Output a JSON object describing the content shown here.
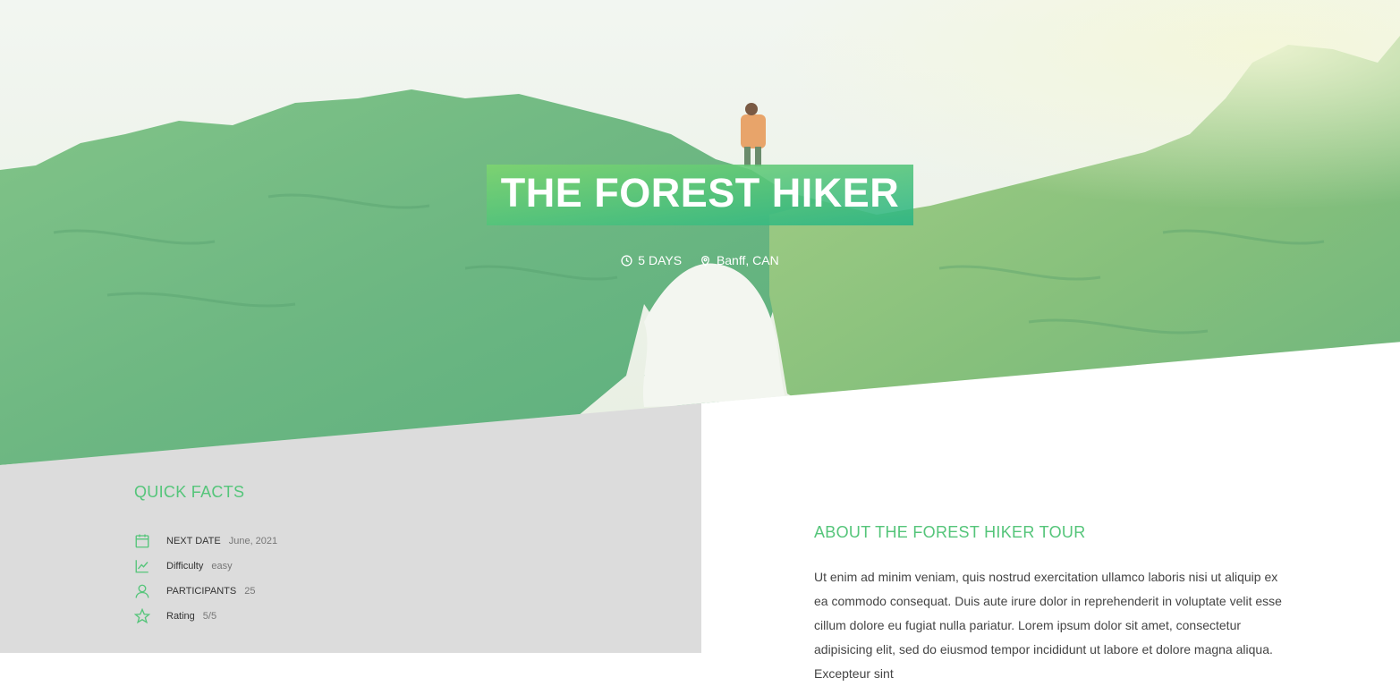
{
  "tour": {
    "title": "THE FOREST HIKER",
    "duration": "5 DAYS",
    "location": "Banff, CAN"
  },
  "quick_facts": {
    "heading": "QUICK FACTS",
    "items": [
      {
        "icon": "calendar-icon",
        "label": "NEXT DATE",
        "value": "June, 2021"
      },
      {
        "icon": "trending-up-icon",
        "label": "Difficulty",
        "value": "easy"
      },
      {
        "icon": "user-icon",
        "label": "PARTICIPANTS",
        "value": "25"
      },
      {
        "icon": "star-icon",
        "label": "Rating",
        "value": "5/5"
      }
    ]
  },
  "about": {
    "heading": "ABOUT THE FOREST HIKER TOUR",
    "text": "Ut enim ad minim veniam, quis nostrud exercitation ullamco laboris nisi ut aliquip ex ea commodo consequat. Duis aute irure dolor in reprehenderit in voluptate velit esse cillum dolore eu fugiat nulla pariatur. Lorem ipsum dolor sit amet, consectetur adipisicing elit, sed do eiusmod tempor incididunt ut labore et dolore magna aliqua. Excepteur sint"
  },
  "colors": {
    "accent": "#55c57a",
    "accent_dark": "#28b485",
    "panel_bg": "#dcdcdc"
  }
}
